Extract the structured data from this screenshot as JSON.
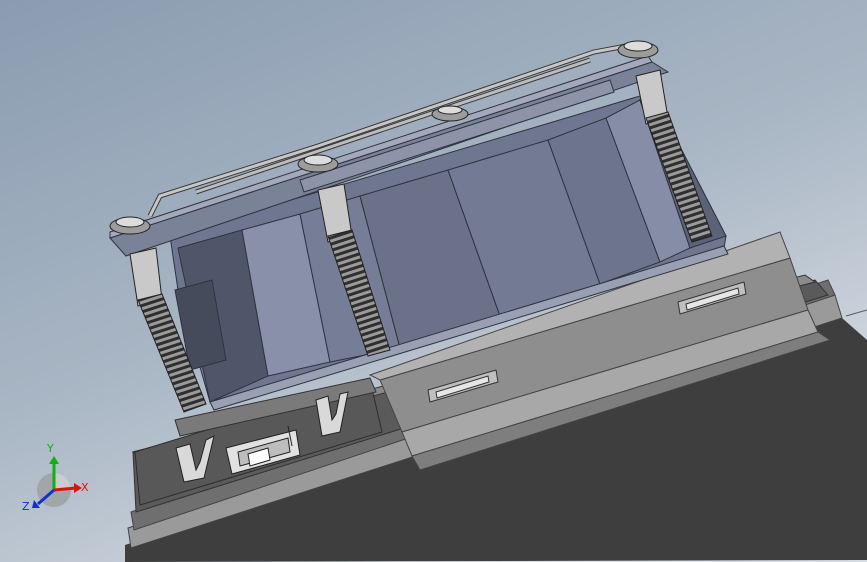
{
  "viewport": {
    "background_top": "#8e9fb3",
    "background_bottom": "#d4dbe3"
  },
  "model": {
    "colors": {
      "plate_light": "#a3a3a3",
      "plate_mid": "#8f8f8f",
      "plate_dark": "#6a6a6a",
      "plate_darker": "#4f4f4f",
      "body_blue": "#707890",
      "body_blue_light": "#8a92ab",
      "body_blue_dark": "#555c70",
      "screw": "#b0b0b0",
      "screw_dark": "#3d3d3d",
      "wire": "#b9b9b9"
    }
  },
  "triad": {
    "x_label": "X",
    "y_label": "Y",
    "z_label": "Z",
    "x_color": "#e01010",
    "y_color": "#10b010",
    "z_color": "#1030d0"
  }
}
